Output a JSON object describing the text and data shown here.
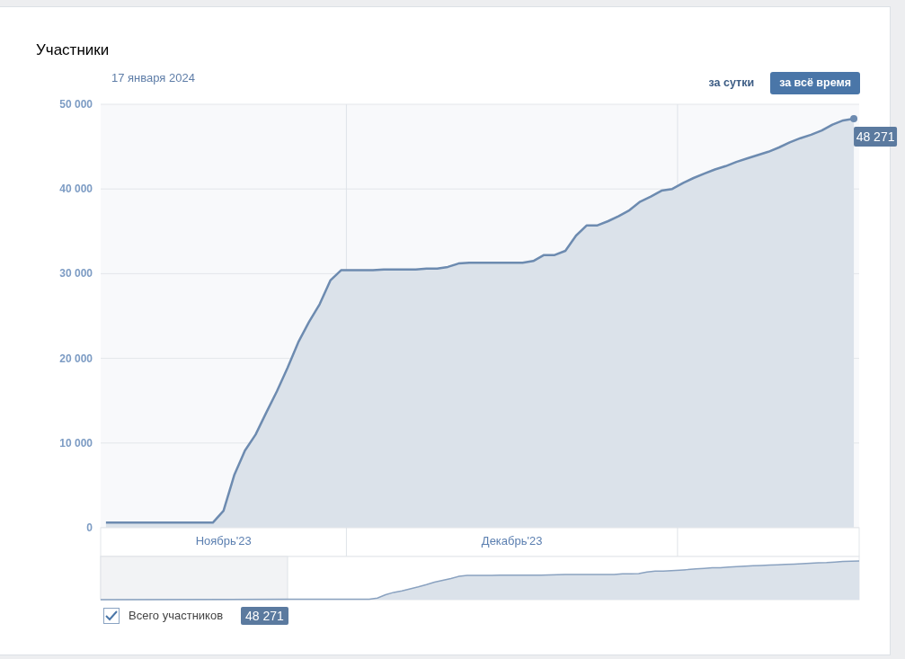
{
  "title": "Участники",
  "date": "17 января 2024",
  "periods": [
    {
      "label": "за сутки",
      "selected": false
    },
    {
      "label": "за всё время",
      "selected": true
    }
  ],
  "chart_data": {
    "type": "area",
    "ylim": [
      0,
      50000
    ],
    "yticks": [
      {
        "value": 0,
        "label": "0"
      },
      {
        "value": 10000,
        "label": "10 000"
      },
      {
        "value": 20000,
        "label": "20 000"
      },
      {
        "value": 30000,
        "label": "30 000"
      },
      {
        "value": 40000,
        "label": "40 000"
      },
      {
        "value": 50000,
        "label": "50 000"
      }
    ],
    "categories": [
      null,
      null,
      null,
      null,
      null,
      null,
      null,
      null,
      null,
      null,
      null,
      "Ноябрь'23",
      null,
      null,
      null,
      null,
      null,
      null,
      null,
      null,
      null,
      null,
      null,
      null,
      null,
      null,
      null,
      null,
      null,
      null,
      null,
      null,
      null,
      null,
      null,
      null,
      null,
      null,
      "Декабрь'23",
      null,
      null,
      null,
      null,
      null,
      null,
      null,
      null,
      null,
      null,
      null,
      null,
      null,
      null,
      null,
      null,
      null,
      null,
      null,
      null,
      null,
      null,
      null,
      null,
      null,
      null,
      null,
      null,
      null,
      null,
      null,
      null
    ],
    "series": [
      {
        "name": "Всего участников",
        "color": "#6d8bb0",
        "values": [
          600,
          600,
          600,
          600,
          600,
          600,
          600,
          600,
          600,
          600,
          600,
          2000,
          6200,
          9100,
          11000,
          13600,
          16100,
          18900,
          21900,
          24300,
          26400,
          29200,
          30400,
          30400,
          30400,
          30400,
          30500,
          30500,
          30500,
          30500,
          30600,
          30600,
          30800,
          31200,
          31300,
          31300,
          31300,
          31300,
          31300,
          31300,
          31500,
          32200,
          32200,
          32700,
          34500,
          35700,
          35700,
          36200,
          36800,
          37500,
          38500,
          39100,
          39800,
          40000,
          40700,
          41300,
          41800,
          42300,
          42700,
          43200,
          43600,
          44000,
          44400,
          44900,
          45500,
          46000,
          46400,
          46900,
          47600,
          48100,
          48300
        ]
      }
    ],
    "grid": true,
    "annotations": [
      "48 271"
    ]
  },
  "legend": [
    {
      "checked": true,
      "value": "48 271"
    }
  ]
}
